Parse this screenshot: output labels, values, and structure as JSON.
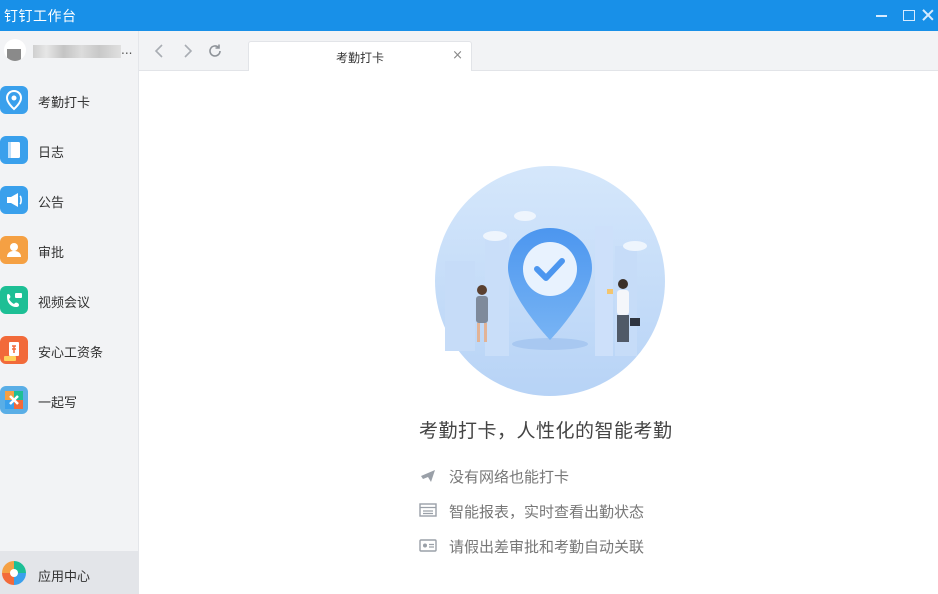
{
  "window": {
    "title": "钉钉工作台"
  },
  "user": {
    "more": "..."
  },
  "sidebar": {
    "items": [
      {
        "label": "考勤打卡",
        "icon": "location-check-icon"
      },
      {
        "label": "日志",
        "icon": "notebook-icon"
      },
      {
        "label": "公告",
        "icon": "megaphone-icon"
      },
      {
        "label": "审批",
        "icon": "approval-person-icon"
      },
      {
        "label": "视频会议",
        "icon": "video-phone-icon"
      },
      {
        "label": "安心工资条",
        "icon": "payslip-icon"
      },
      {
        "label": "一起写",
        "icon": "co-write-icon"
      }
    ],
    "footer": {
      "label": "应用中心",
      "icon": "app-center-icon"
    }
  },
  "tabs": [
    {
      "label": "考勤打卡",
      "close": "×"
    }
  ],
  "main": {
    "headline": "考勤打卡，人性化的智能考勤",
    "features": [
      {
        "icon": "airplane-icon",
        "text": "没有网络也能打卡"
      },
      {
        "icon": "report-icon",
        "text": "智能报表，实时查看出勤状态"
      },
      {
        "icon": "id-card-icon",
        "text": "请假出差审批和考勤自动关联"
      }
    ]
  },
  "colors": {
    "titlebar": "#1890e8",
    "sidebar": "#f2f3f5",
    "accent": "#3aa0ec"
  }
}
